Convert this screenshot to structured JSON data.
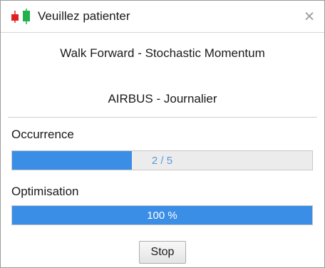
{
  "window": {
    "title": "Veuillez patienter",
    "icon": "candlestick-chart-icon",
    "icon_colors": {
      "bearish": "#e02020",
      "bullish": "#22b14c"
    },
    "close_icon": "close-icon",
    "close_glyph": "×"
  },
  "content": {
    "strategy_line": "Walk Forward - Stochastic Momentum",
    "instrument_line": "AIRBUS - Journalier"
  },
  "occurrence": {
    "label": "Occurrence",
    "progress_text": "2 / 5",
    "progress_fraction": 0.4
  },
  "optimisation": {
    "label": "Optimisation",
    "progress_text": "100 %",
    "progress_fraction": 1.0
  },
  "buttons": {
    "stop_label": "Stop"
  },
  "colors": {
    "progress_fill": "#3a8ee6",
    "progress_track": "#ececec"
  }
}
